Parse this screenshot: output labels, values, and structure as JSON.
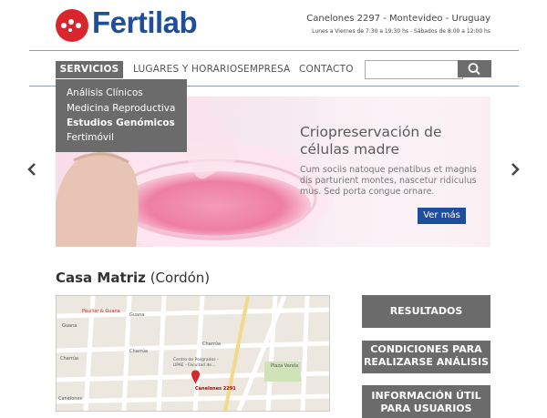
{
  "brand": {
    "name": "Fertilab"
  },
  "header": {
    "address": "Canelones 2297 - Montevideo - Uruguay",
    "hours": "Lunes a Viernes de 7:30 a 19:30 hs - Sábados de 8:00 a 12:00 hs"
  },
  "nav": {
    "items": [
      "SERVICIOS",
      "LUGARES Y HORARIOS",
      "EMPRESA",
      "CONTACTO"
    ],
    "search_value": ""
  },
  "dropdown": {
    "items": [
      "Análisis Clínicos",
      "Medicina Reproductiva",
      "Estudios Genómicos",
      "Fertimóvil"
    ]
  },
  "hero": {
    "title": "Criopreservación de células madre",
    "text": "Cum sociis natoque penatibus et magnis dis parturient montes, nascetur ridiculus mus. Sed porta congue ornare.",
    "button": "Ver más"
  },
  "location": {
    "title": "Casa Matriz",
    "subtitle": "(Cordón)"
  },
  "map": {
    "streets": [
      "Guana",
      "Paullier & Guana",
      "Charrúa",
      "Alfredo Díaz",
      "Av. Brasil",
      "Bulevar General Artigas",
      "Av. Ing. Luis",
      "Obispo",
      "Canelones",
      "Plaza Varela",
      "Centro de Posgrados - UPAE - Facultad de..."
    ],
    "pin_label": "Canelones 2291"
  },
  "sidebar": {
    "buttons": [
      "RESULTADOS",
      "CONDICIONES PARA REALIZARSE ANÁLISIS",
      "INFORMACIÓN ÚTIL PARA USUARIOS"
    ]
  },
  "colors": {
    "brand_blue": "#1f4e9c",
    "brand_red": "#d8262c",
    "nav_gray": "#6b6b6b"
  }
}
